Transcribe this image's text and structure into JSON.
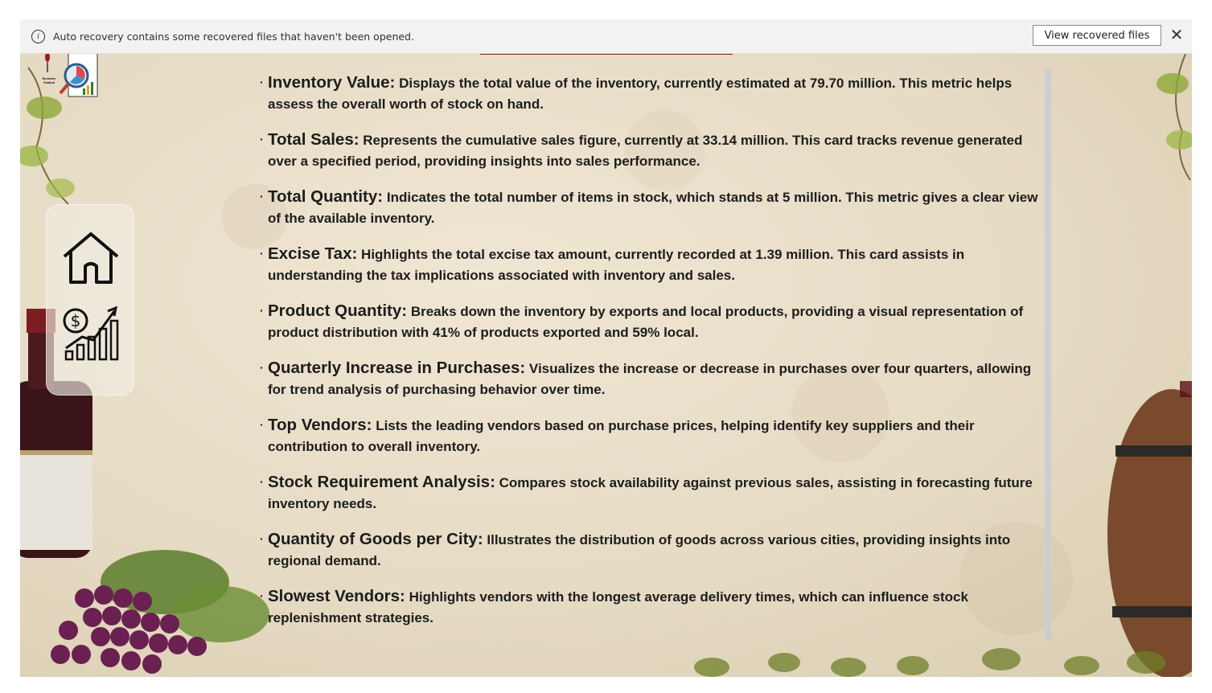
{
  "notification": {
    "message": "Auto recovery contains some recovered files that haven't been opened.",
    "view_button": "View recovered files",
    "close_symbol": "✕"
  },
  "logo": {
    "text_line1": "Inventory",
    "text_line2": "Analysis"
  },
  "nav": [
    {
      "name": "home",
      "icon": "home-icon"
    },
    {
      "name": "sales",
      "icon": "dollar-growth-chart-icon"
    }
  ],
  "colors": {
    "title_bar": "#7b2b22",
    "text": "#1d1d1d",
    "scrollbar": "#c9cdd6"
  },
  "items": [
    {
      "term": "Inventory Value:",
      "desc": " Displays the total value of the inventory, currently estimated at 79.70 million. This metric helps assess the overall worth of stock on hand."
    },
    {
      "term": "Total Sales:",
      "desc": " Represents the cumulative sales figure, currently at 33.14 million. This card tracks revenue generated over a specified period, providing insights into sales performance."
    },
    {
      "term": "Total Quantity:",
      "desc": " Indicates the total number of items in stock, which stands at 5 million. This metric gives a clear view of the available inventory."
    },
    {
      "term": "Excise Tax:",
      "desc": " Highlights the total excise tax amount, currently recorded at 1.39 million. This card assists in understanding the tax implications associated with inventory and sales."
    },
    {
      "term": "Product Quantity:",
      "desc": " Breaks down the inventory by exports and local products, providing a visual representation of product distribution with 41% of products exported and 59% local."
    },
    {
      "term": "Quarterly Increase in Purchases:",
      "desc": " Visualizes the increase or decrease in purchases over four quarters, allowing for trend analysis of purchasing behavior over time."
    },
    {
      "term": "Top Vendors:",
      "desc": " Lists the leading vendors based on purchase prices, helping identify key suppliers and their contribution to overall inventory."
    },
    {
      "term": "Stock Requirement Analysis:",
      "desc": " Compares stock availability against previous sales, assisting in forecasting future inventory needs."
    },
    {
      "term": "Quantity of Goods per City:",
      "desc": " Illustrates the distribution of goods across various cities, providing insights into regional demand."
    },
    {
      "term": "Slowest Vendors:",
      "desc": " Highlights vendors with the longest average delivery times, which can influence stock replenishment strategies."
    }
  ]
}
